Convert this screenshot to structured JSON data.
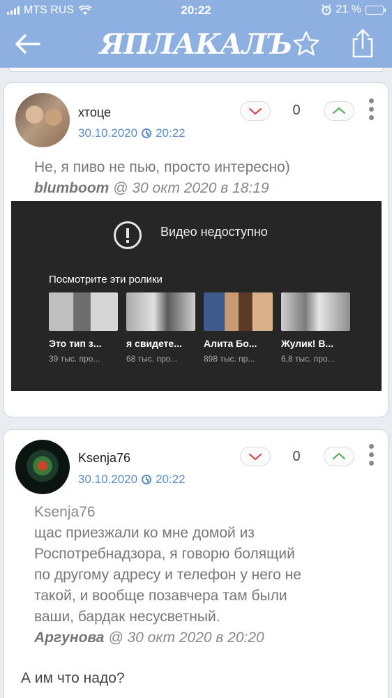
{
  "status_bar": {
    "carrier": "MTS RUS",
    "time": "20:22",
    "battery": "21 %",
    "battery_level": 0.21
  },
  "header": {
    "logo": "ЯПЛАКАЛЪ",
    "accent_color": "#8db0e0"
  },
  "comments": [
    {
      "username": "хтоце",
      "date": "30.10.2020",
      "time": "20:22",
      "score": "0",
      "quote_text": "Не, я пиво не пью, просто интересно)",
      "quote_author": "blumboom",
      "quote_date": "@ 30 окт 2020 в 18:19",
      "video": {
        "title": "Видео недоступно",
        "subtitle": "Посмотрите эти ролики",
        "items": [
          {
            "title": "Это тип з...",
            "views": "39 тыс. про..."
          },
          {
            "title": "я свидете...",
            "views": "68 тыс. про..."
          },
          {
            "title": "Алита Бо...",
            "views": "898 тыс. пр..."
          },
          {
            "title": "Жулик! В...",
            "views": "6,8 тыс. про..."
          }
        ]
      }
    },
    {
      "username": "Ksenja76",
      "date": "30.10.2020",
      "time": "20:22",
      "score": "0",
      "body_lines": [
        "Ksenja76",
        "щас приезжали ко мне домой из",
        "Роспотребнадзора, я говорю болящий",
        "по другому адресу и телефон у него не",
        "такой, и вообще позавчера там были",
        "ваши, бардак несусветный."
      ],
      "quote_author": "Аргунова",
      "quote_date": "@ 30 окт 2020 в 20:20",
      "reply": "А им что надо?"
    }
  ]
}
